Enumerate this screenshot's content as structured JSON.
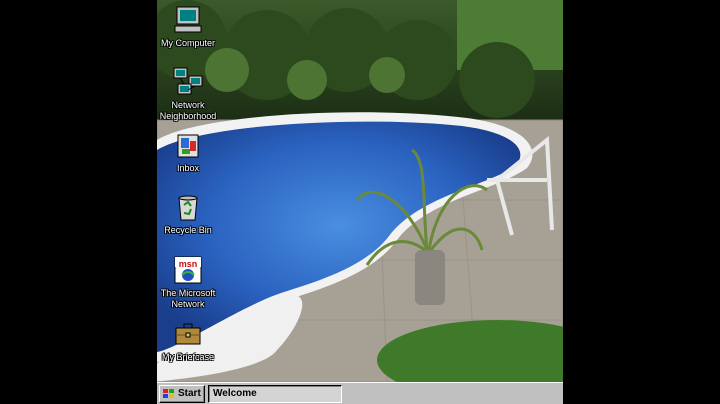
{
  "desktop": {
    "icons": [
      {
        "label": "My Computer",
        "icon": "my-computer-icon"
      },
      {
        "label": "Network Neighborhood",
        "icon": "network-neighborhood-icon"
      },
      {
        "label": "Inbox",
        "icon": "inbox-icon"
      },
      {
        "label": "Recycle Bin",
        "icon": "recycle-bin-icon"
      },
      {
        "label": "The Microsoft Network",
        "icon": "msn-icon"
      },
      {
        "label": "My Briefcase",
        "icon": "briefcase-icon"
      }
    ],
    "wallpaper": "swimming-pool-photo"
  },
  "taskbar": {
    "start_label": "Start",
    "tasks": [
      {
        "label": "Welcome"
      }
    ],
    "background_color": "#c0c0c0"
  }
}
